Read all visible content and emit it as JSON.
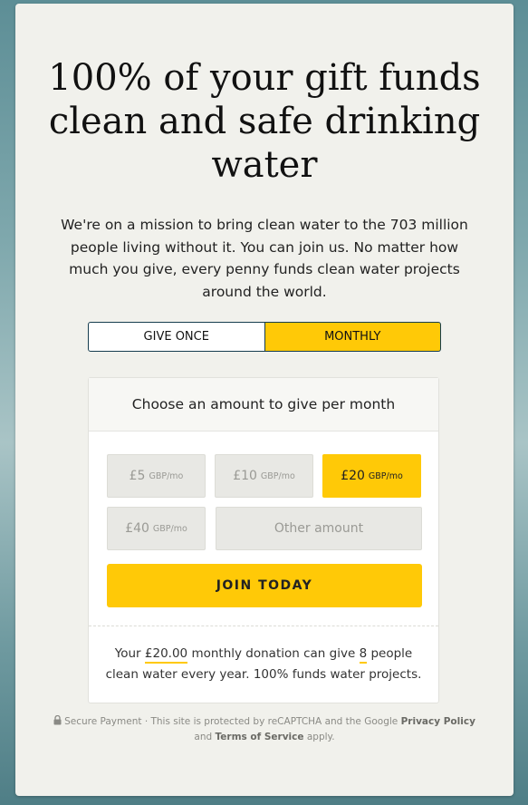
{
  "headline": "100% of your gift funds clean and safe drinking water",
  "intro": "We're on a mission to bring clean water to the 703 million people living without it. You can join us. No matter how much you give, every penny funds clean water projects around the world.",
  "frequency": {
    "once_label": "GIVE ONCE",
    "monthly_label": "MONTHLY",
    "selected": "MONTHLY"
  },
  "panel": {
    "title": "Choose an amount to give per month",
    "amounts": [
      {
        "value": "£5",
        "unit": "GBP/mo",
        "selected": false
      },
      {
        "value": "£10",
        "unit": "GBP/mo",
        "selected": false
      },
      {
        "value": "£20",
        "unit": "GBP/mo",
        "selected": true
      },
      {
        "value": "£40",
        "unit": "GBP/mo",
        "selected": false
      }
    ],
    "other_placeholder": "Other amount",
    "join_label": "JOIN TODAY",
    "impact": {
      "prefix": "Your",
      "amount": "£20.00",
      "middle": "monthly donation can give",
      "people": "8",
      "suffix": "people clean water every year. 100% funds water projects."
    }
  },
  "footer": {
    "secure_label": "Secure Payment",
    "recaptcha_text": "· This site is protected by reCAPTCHA and the Google",
    "privacy_link": "Privacy Policy",
    "and_text": "and",
    "terms_link": "Terms of Service",
    "apply_text": "apply."
  },
  "colors": {
    "accent": "#ffc907",
    "border_dark": "#163d4f",
    "card_bg": "#f1f1ec"
  }
}
